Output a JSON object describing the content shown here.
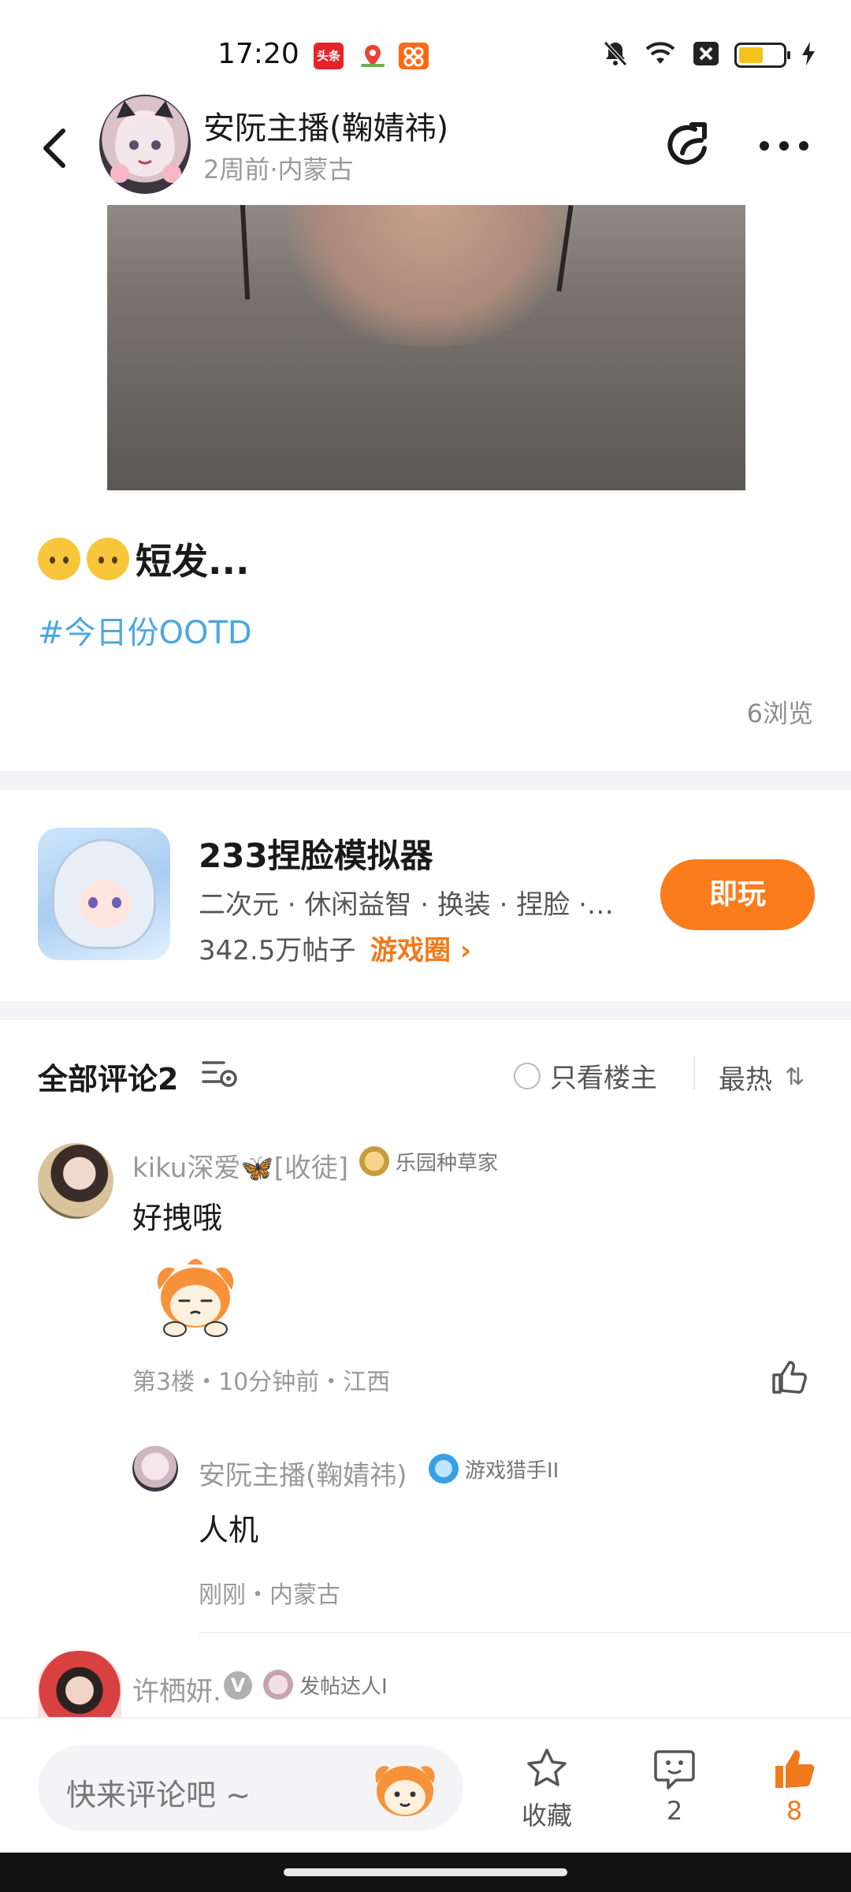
{
  "status_bar": {
    "time": "17:20",
    "app_icons": [
      "toutiao-icon",
      "map-icon",
      "taobao-icon"
    ],
    "system_icons": [
      "mute-icon",
      "wifi-icon",
      "sim-off-icon",
      "battery-icon",
      "charging-icon"
    ],
    "battery_level": 0.55,
    "toutiao_label": "头条"
  },
  "header": {
    "author_name": "安阮主播(鞠婧祎)",
    "meta": "2周前·内蒙古"
  },
  "post": {
    "text": "短发...",
    "emoji_count": 2,
    "hashtag": "#今日份OOTD",
    "views": "6浏览"
  },
  "game_card": {
    "title": "233捏脸模拟器",
    "tags": "二次元 · 休闲益智 · 换装 · 捏脸 · ...",
    "posts": "342.5万帖子",
    "circle_link": "游戏圈 ›",
    "play_button": "即玩"
  },
  "comments_header": {
    "title": "全部评论2",
    "only_host": "只看楼主",
    "sort": "最热",
    "sort_arrows": "⇅"
  },
  "comments": [
    {
      "name": "kiku深爱🦋[收徒]",
      "badge": "乐园种草家",
      "text": "好拽哦",
      "meta": "第3楼・10分钟前・江西",
      "reply": {
        "name": "安阮主播(鞠婧祎)",
        "badge": "游戏猎手II",
        "text": "人机",
        "meta": "刚刚・内蒙古"
      }
    },
    {
      "name": "许栖妍.",
      "verified": "V",
      "badge": "发帖达人I"
    }
  ],
  "bottom_bar": {
    "input_placeholder": "快来评论吧 ~",
    "favorite_label": "收藏",
    "comment_count": "2",
    "like_count": "8"
  },
  "colors": {
    "accent_orange": "#fa7c1c",
    "hashtag_blue": "#4aa8e0",
    "text_dark": "#1a1a1a",
    "text_gray": "#999999"
  }
}
